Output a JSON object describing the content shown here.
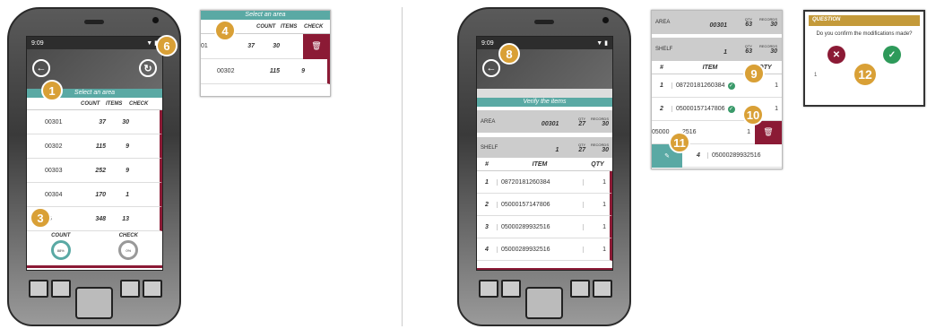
{
  "colors": {
    "teal": "#5aa9a4",
    "accent": "#8b1a35",
    "badge": "#d9a036",
    "confirm": "#2e9a5a",
    "question": "#c49a3a"
  },
  "left_device": {
    "status_time": "9:09",
    "title": "Select an area",
    "headers": {
      "count": "COUNT",
      "items": "ITEMS",
      "check": "CHECK"
    },
    "rows": [
      {
        "area": "00301",
        "count": "37",
        "items": "30"
      },
      {
        "area": "00302",
        "count": "115",
        "items": "9"
      },
      {
        "area": "00303",
        "count": "252",
        "items": "9"
      },
      {
        "area": "00304",
        "count": "170",
        "items": "1"
      },
      {
        "area": "05",
        "count": "348",
        "items": "13"
      }
    ],
    "gauge_count_label": "COUNT",
    "gauge_check_label": "CHECK",
    "gauge_count_value": "88%",
    "gauge_check_value": "0%"
  },
  "panel4": {
    "title": "Select an area",
    "headers": {
      "count": "COUNT",
      "items": "ITEMS",
      "check": "CHECK"
    },
    "rows": [
      {
        "area": "01",
        "count": "37",
        "items": "30"
      },
      {
        "area": "00302",
        "count": "115",
        "items": "9"
      }
    ]
  },
  "right_device": {
    "status_time": "9:09",
    "title": "Verify the items",
    "area_label": "AREA",
    "area_value": "00301",
    "qty_label": "QTY",
    "records_label": "RECORDS",
    "area_qty": "27",
    "area_records": "30",
    "shelf_label": "SHELF",
    "shelf_value": "1",
    "shelf_qty": "27",
    "shelf_records": "30",
    "headers": {
      "num": "#",
      "item": "ITEM",
      "qty": "QTY"
    },
    "items": [
      {
        "n": "1",
        "code": "08720181260384",
        "qty": "1"
      },
      {
        "n": "2",
        "code": "05000157147806",
        "qty": "1"
      },
      {
        "n": "3",
        "code": "05000289932516",
        "qty": "1"
      },
      {
        "n": "4",
        "code": "05000289932516",
        "qty": "1"
      }
    ]
  },
  "panel_verify": {
    "area_label": "AREA",
    "area_value": "00301",
    "qty_label": "QTY",
    "records_label": "RECORDS",
    "area_qty": "63",
    "area_records": "30",
    "shelf_label": "SHELF",
    "shelf_value": "1",
    "shelf_qty": "63",
    "shelf_records": "30",
    "headers": {
      "num": "#",
      "item": "ITEM",
      "qty": "QTY"
    },
    "items": [
      {
        "n": "1",
        "code": "08720181260384",
        "qty": "1"
      },
      {
        "n": "2",
        "code": "05000157147806",
        "qty": "1"
      },
      {
        "n": "",
        "code": "05000",
        "code2": "2516",
        "qty": "1"
      },
      {
        "n": "4",
        "code": "05000289932516",
        "qty": ""
      }
    ]
  },
  "question_panel": {
    "header": "QUESTION",
    "text": "Do you confirm the modifications made?",
    "bg_code": "1"
  },
  "badges": [
    "1",
    "3",
    "4",
    "6",
    "8",
    "9",
    "10",
    "11",
    "12"
  ]
}
